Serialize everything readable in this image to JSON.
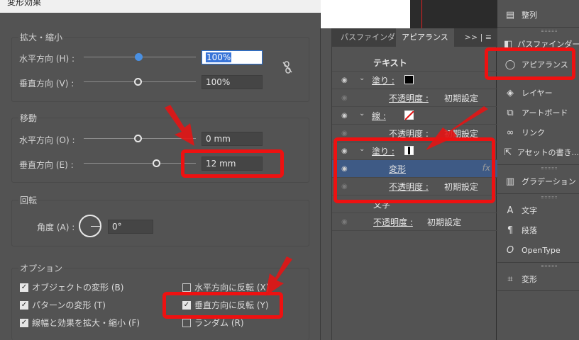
{
  "dialog": {
    "title": "変形効果",
    "scale": {
      "title": "拡大・縮小",
      "horizontal_label": "水平方向 (H) :",
      "horizontal_value": "100%",
      "vertical_label": "垂直方向 (V) :",
      "vertical_value": "100%"
    },
    "move": {
      "title": "移動",
      "horizontal_label": "水平方向 (O) :",
      "horizontal_value": "0 mm",
      "vertical_label": "垂直方向 (E) :",
      "vertical_value": "12 mm"
    },
    "rotate": {
      "title": "回転",
      "angle_label": "角度 (A) :",
      "angle_value": "0°"
    },
    "options": {
      "title": "オプション",
      "transform_objects": "オブジェクトの変形 (B)",
      "transform_patterns": "パターンの変形 (T)",
      "scale_strokes": "線幅と効果を拡大・縮小 (F)",
      "reflect_x": "水平方向に反転 (X)",
      "reflect_y": "垂直方向に反転 (Y)",
      "random": "ランダム (R)"
    }
  },
  "appearance": {
    "tabs": [
      "パスファインダー",
      "アピアランス"
    ],
    "menu_glyph": ">> | ≡",
    "rows": [
      {
        "label": "テキスト"
      },
      {
        "label": "塗り :"
      },
      {
        "label": "不透明度 :",
        "value": "初期設定"
      },
      {
        "label": "線 :"
      },
      {
        "label": "不透明度 :",
        "value": "初期設定"
      },
      {
        "label": "塗り :"
      },
      {
        "label": "変形",
        "fx": "fx"
      },
      {
        "label": "不透明度 :",
        "value": "初期設定"
      },
      {
        "label": "文字"
      },
      {
        "label": "不透明度 :",
        "value": "初期設定"
      }
    ]
  },
  "dock": {
    "items": [
      {
        "label": "整列"
      },
      {
        "label": "パスファインダー"
      },
      {
        "label": "アピアランス"
      },
      {
        "label": "レイヤー"
      },
      {
        "label": "アートボード"
      },
      {
        "label": "リンク"
      },
      {
        "label": "アセットの書き..."
      },
      {
        "label": "グラデーション"
      },
      {
        "label": "文字"
      },
      {
        "label": "段落"
      },
      {
        "label": "OpenType"
      },
      {
        "label": "変形"
      }
    ]
  },
  "colors": {
    "panel_bg": "#535353",
    "highlight_red": "#ee1111",
    "selection_blue": "#3e5a85",
    "focus_blue": "#3874d8"
  }
}
